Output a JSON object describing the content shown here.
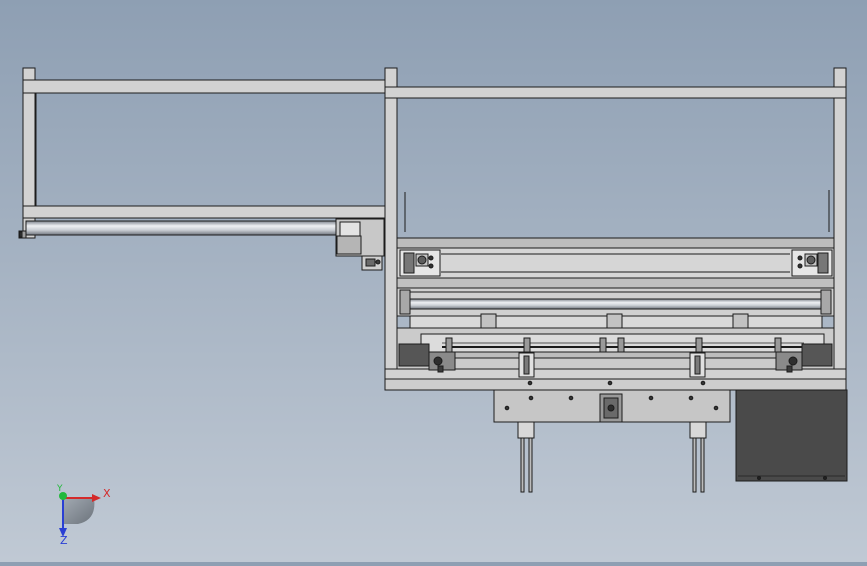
{
  "viewport": {
    "background_top": "#8e9fb3",
    "background_bottom": "#c0c9d4"
  },
  "model": {
    "frame_color": "#d2d2d2",
    "frame_stroke": "#1c1c1c",
    "rod_color": "#b9bec6",
    "plate_color": "#c6c6c6",
    "motor_color": "#565656",
    "cabinet_color": "#4a4a4a"
  },
  "triad": {
    "x_label": "X",
    "y_label": "Y",
    "z_label": "Z",
    "x_color": "#d42a2a",
    "y_color": "#22b83c",
    "z_color": "#2a3fd4"
  }
}
